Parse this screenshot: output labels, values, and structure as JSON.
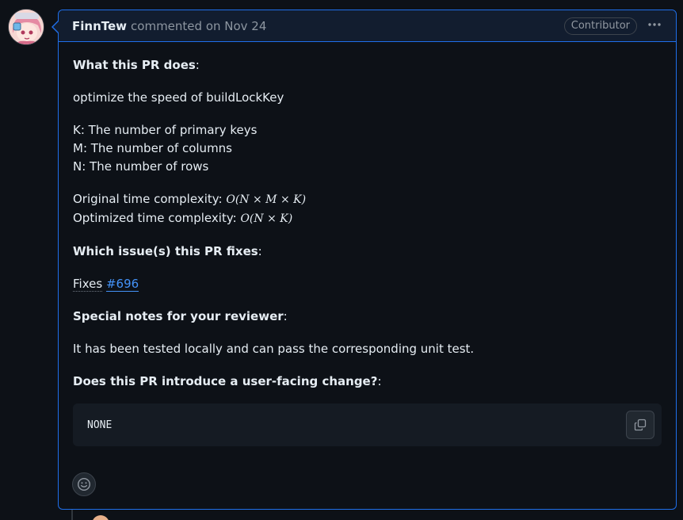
{
  "comment": {
    "author": "FinnTew",
    "meta": "commented on Nov 24",
    "badge": "Contributor",
    "menu_icon": "kebab-horizontal-icon"
  },
  "body": {
    "h1": "What this PR does",
    "colon": ":",
    "summary": "optimize the speed of buildLockKey",
    "defs": [
      "K: The number of primary keys",
      "M: The number of columns",
      "N: The number of rows"
    ],
    "original_label": "Original time complexity: ",
    "original_expr": "O(N × M × K)",
    "optimized_label": "Optimized time complexity: ",
    "optimized_expr": "O(N × K)",
    "h2": "Which issue(s) this PR fixes",
    "fixes_word": "Fixes",
    "issue_ref": "#696",
    "h3": "Special notes for your reviewer",
    "notes": "It has been tested locally and can pass the corresponding unit test.",
    "h4": "Does this PR introduce a user-facing change?",
    "code": "NONE"
  },
  "icons": {
    "copy": "copy-icon",
    "reaction": "smiley-icon"
  },
  "colors": {
    "accent": "#1f6feb",
    "link": "#4493f8",
    "background": "#0d1117"
  }
}
